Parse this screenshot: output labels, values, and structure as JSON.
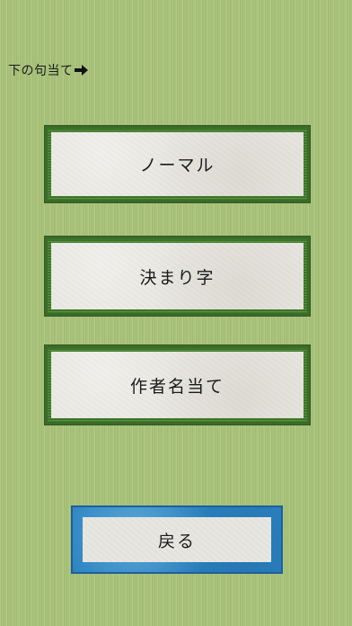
{
  "header": {
    "mode_label": "下の句当て",
    "arrow_icon": "right-arrow-icon"
  },
  "menu": {
    "normal_label": "ノーマル",
    "kimariji_label": "決まり字",
    "author_label": "作者名当て"
  },
  "footer": {
    "back_label": "戻る"
  },
  "colors": {
    "background": "#a9c27a",
    "button_border": "#3c6a2a",
    "button_face": "#e8e6e0",
    "back_border": "#2c83c0"
  }
}
